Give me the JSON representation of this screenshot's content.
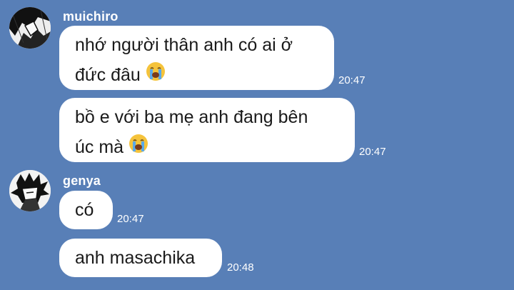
{
  "chat": {
    "background": "#587fb7",
    "groups": [
      {
        "sender": "muichiro",
        "avatar_icon": "manga-character-avatar",
        "messages": [
          {
            "lines": [
              "nhớ người thân anh có ai ở",
              "đức đâu"
            ],
            "emoji": "loudly-crying-face",
            "time": "20:47"
          },
          {
            "lines": [
              "bồ e với ba mẹ anh đang bên",
              "úc mà"
            ],
            "emoji": "loudly-crying-face",
            "time": "20:47"
          }
        ]
      },
      {
        "sender": "genya",
        "avatar_icon": "manga-character-avatar",
        "messages": [
          {
            "lines": [
              "có"
            ],
            "time": "20:47"
          },
          {
            "lines": [
              "anh masachika"
            ],
            "time": "20:48"
          }
        ]
      }
    ]
  }
}
